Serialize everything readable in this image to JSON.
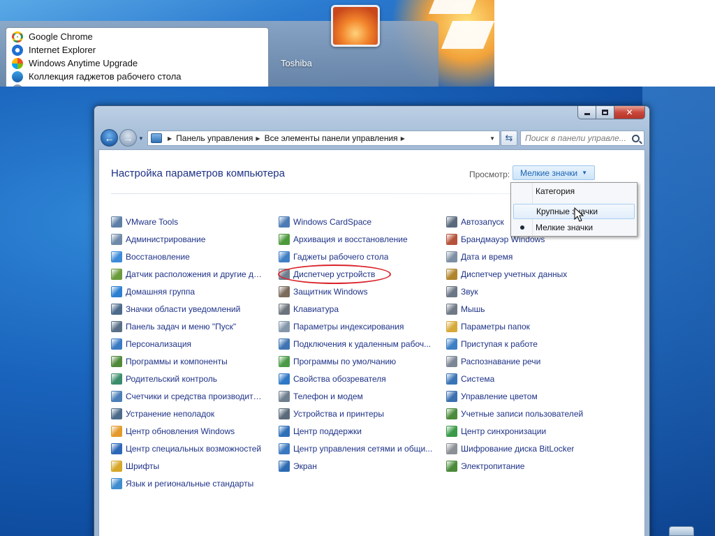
{
  "start_menu": {
    "programs": [
      {
        "label": "Google Chrome",
        "icon": "chrome-icon"
      },
      {
        "label": "Internet Explorer",
        "icon": "internet-explorer-icon"
      },
      {
        "label": "Windows Anytime Upgrade",
        "icon": "windows-anytime-upgrade-icon"
      },
      {
        "label": "Коллекция гаджетов рабочего стола",
        "icon": "gadgets-gallery-icon"
      }
    ],
    "user_name": "Toshiba"
  },
  "window": {
    "breadcrumbs": [
      "Панель управления",
      "Все элементы панели управления"
    ],
    "search_placeholder": "Поиск в панели управле...",
    "title": "Настройка параметров компьютера",
    "view_label": "Просмотр:",
    "view_value": "Мелкие значки",
    "view_menu": {
      "items": [
        {
          "label": "Категория",
          "selected": false,
          "hovered": false
        },
        {
          "label": "Крупные значки",
          "selected": false,
          "hovered": true
        },
        {
          "label": "Мелкие значки",
          "selected": true,
          "hovered": false
        }
      ]
    },
    "columns": [
      [
        {
          "label": "VMware Tools",
          "icon": "vmware-icon",
          "color": "#5d7fa6"
        },
        {
          "label": "Администрирование",
          "icon": "admin-tools-icon",
          "color": "#6f8aa8"
        },
        {
          "label": "Восстановление",
          "icon": "recovery-icon",
          "color": "#3d8ad9"
        },
        {
          "label": "Датчик расположения и другие дат...",
          "icon": "location-sensor-icon",
          "color": "#6a9b3c"
        },
        {
          "label": "Домашняя группа",
          "icon": "homegroup-icon",
          "color": "#2c7fd1"
        },
        {
          "label": "Значки области уведомлений",
          "icon": "notification-icons-icon",
          "color": "#4c6a8a"
        },
        {
          "label": "Панель задач и меню \"Пуск\"",
          "icon": "taskbar-icon",
          "color": "#5a6f86"
        },
        {
          "label": "Персонализация",
          "icon": "personalization-icon",
          "color": "#3b7bc4"
        },
        {
          "label": "Программы и компоненты",
          "icon": "programs-features-icon",
          "color": "#4f8a3a"
        },
        {
          "label": "Родительский контроль",
          "icon": "parental-controls-icon",
          "color": "#3a8c6b"
        },
        {
          "label": "Счетчики и средства производител...",
          "icon": "performance-icon",
          "color": "#4a7fb8"
        },
        {
          "label": "Устранение неполадок",
          "icon": "troubleshooting-icon",
          "color": "#4c6a8a"
        },
        {
          "label": "Центр обновления Windows",
          "icon": "windows-update-icon",
          "color": "#e39a2b"
        },
        {
          "label": "Центр специальных возможностей",
          "icon": "ease-of-access-icon",
          "color": "#2c66b6"
        },
        {
          "label": "Шрифты",
          "icon": "fonts-icon",
          "color": "#d6a729"
        },
        {
          "label": "Язык и региональные стандарты",
          "icon": "region-language-icon",
          "color": "#3f8ccf"
        }
      ],
      [
        {
          "label": "Windows CardSpace",
          "icon": "cardspace-icon",
          "color": "#4c7bb5"
        },
        {
          "label": "Архивация и восстановление",
          "icon": "backup-restore-icon",
          "color": "#4d9a3c"
        },
        {
          "label": "Гаджеты рабочего стола",
          "icon": "desktop-gadgets-icon",
          "color": "#3f7fc6"
        },
        {
          "label": "Диспетчер устройств",
          "icon": "device-manager-icon",
          "color": "#6f7e8e"
        },
        {
          "label": "Защитник Windows",
          "icon": "windows-defender-icon",
          "color": "#7a6b5c"
        },
        {
          "label": "Клавиатура",
          "icon": "keyboard-icon",
          "color": "#6c737c"
        },
        {
          "label": "Параметры индексирования",
          "icon": "indexing-options-icon",
          "color": "#8496aa"
        },
        {
          "label": "Подключения к удаленным рабоч...",
          "icon": "remote-connections-icon",
          "color": "#3e74b3"
        },
        {
          "label": "Программы по умолчанию",
          "icon": "default-programs-icon",
          "color": "#4c9a47"
        },
        {
          "label": "Свойства обозревателя",
          "icon": "internet-options-icon",
          "color": "#2f78c6"
        },
        {
          "label": "Телефон и модем",
          "icon": "phone-modem-icon",
          "color": "#6f7e8e"
        },
        {
          "label": "Устройства и принтеры",
          "icon": "devices-printers-icon",
          "color": "#5b6a7a"
        },
        {
          "label": "Центр поддержки",
          "icon": "action-center-icon",
          "color": "#2f6fb8"
        },
        {
          "label": "Центр управления сетями и общи...",
          "icon": "network-center-icon",
          "color": "#3a78c0"
        },
        {
          "label": "Экран",
          "icon": "display-icon",
          "color": "#2c6ab3"
        }
      ],
      [
        {
          "label": "Автозапуск",
          "icon": "autoplay-icon",
          "color": "#5a6a7d"
        },
        {
          "label": "Брандмауэр Windows",
          "icon": "firewall-icon",
          "color": "#b5523a"
        },
        {
          "label": "Дата и время",
          "icon": "date-time-icon",
          "color": "#7d8fa3"
        },
        {
          "label": "Диспетчер учетных данных",
          "icon": "credential-manager-icon",
          "color": "#b0852d"
        },
        {
          "label": "Звук",
          "icon": "sound-icon",
          "color": "#6b7686"
        },
        {
          "label": "Мышь",
          "icon": "mouse-icon",
          "color": "#707a86"
        },
        {
          "label": "Параметры папок",
          "icon": "folder-options-icon",
          "color": "#d7a93a"
        },
        {
          "label": "Приступая к работе",
          "icon": "getting-started-icon",
          "color": "#3c7fc5"
        },
        {
          "label": "Распознавание речи",
          "icon": "speech-recognition-icon",
          "color": "#7c8796"
        },
        {
          "label": "Система",
          "icon": "system-icon",
          "color": "#3b74b6"
        },
        {
          "label": "Управление цветом",
          "icon": "color-management-icon",
          "color": "#3c6fb0"
        },
        {
          "label": "Учетные записи пользователей",
          "icon": "user-accounts-icon",
          "color": "#4a8a3a"
        },
        {
          "label": "Центр синхронизации",
          "icon": "sync-center-icon",
          "color": "#3a9a48"
        },
        {
          "label": "Шифрование диска BitLocker",
          "icon": "bitlocker-icon",
          "color": "#8b8f96"
        },
        {
          "label": "Электропитание",
          "icon": "power-options-icon",
          "color": "#4a8a3a"
        }
      ]
    ]
  },
  "colors": {
    "link": "#1e3287",
    "highlight_oval": "#d9232a",
    "view_select_text": "#1a63b4"
  }
}
